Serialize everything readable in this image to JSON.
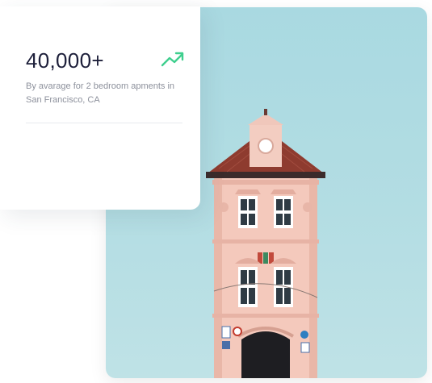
{
  "stat": {
    "value": "40,000+",
    "description": "By avarage for 2 bedroom apments in San Francisco, CA",
    "trend_icon": "trending-up-icon",
    "trend_color": "#3fcf8e"
  },
  "photo": {
    "subject": "pink-house-photo",
    "sky_color": "#aed9e0",
    "house_color": "#f2c2b5",
    "roof_color": "#8a3a2e"
  }
}
